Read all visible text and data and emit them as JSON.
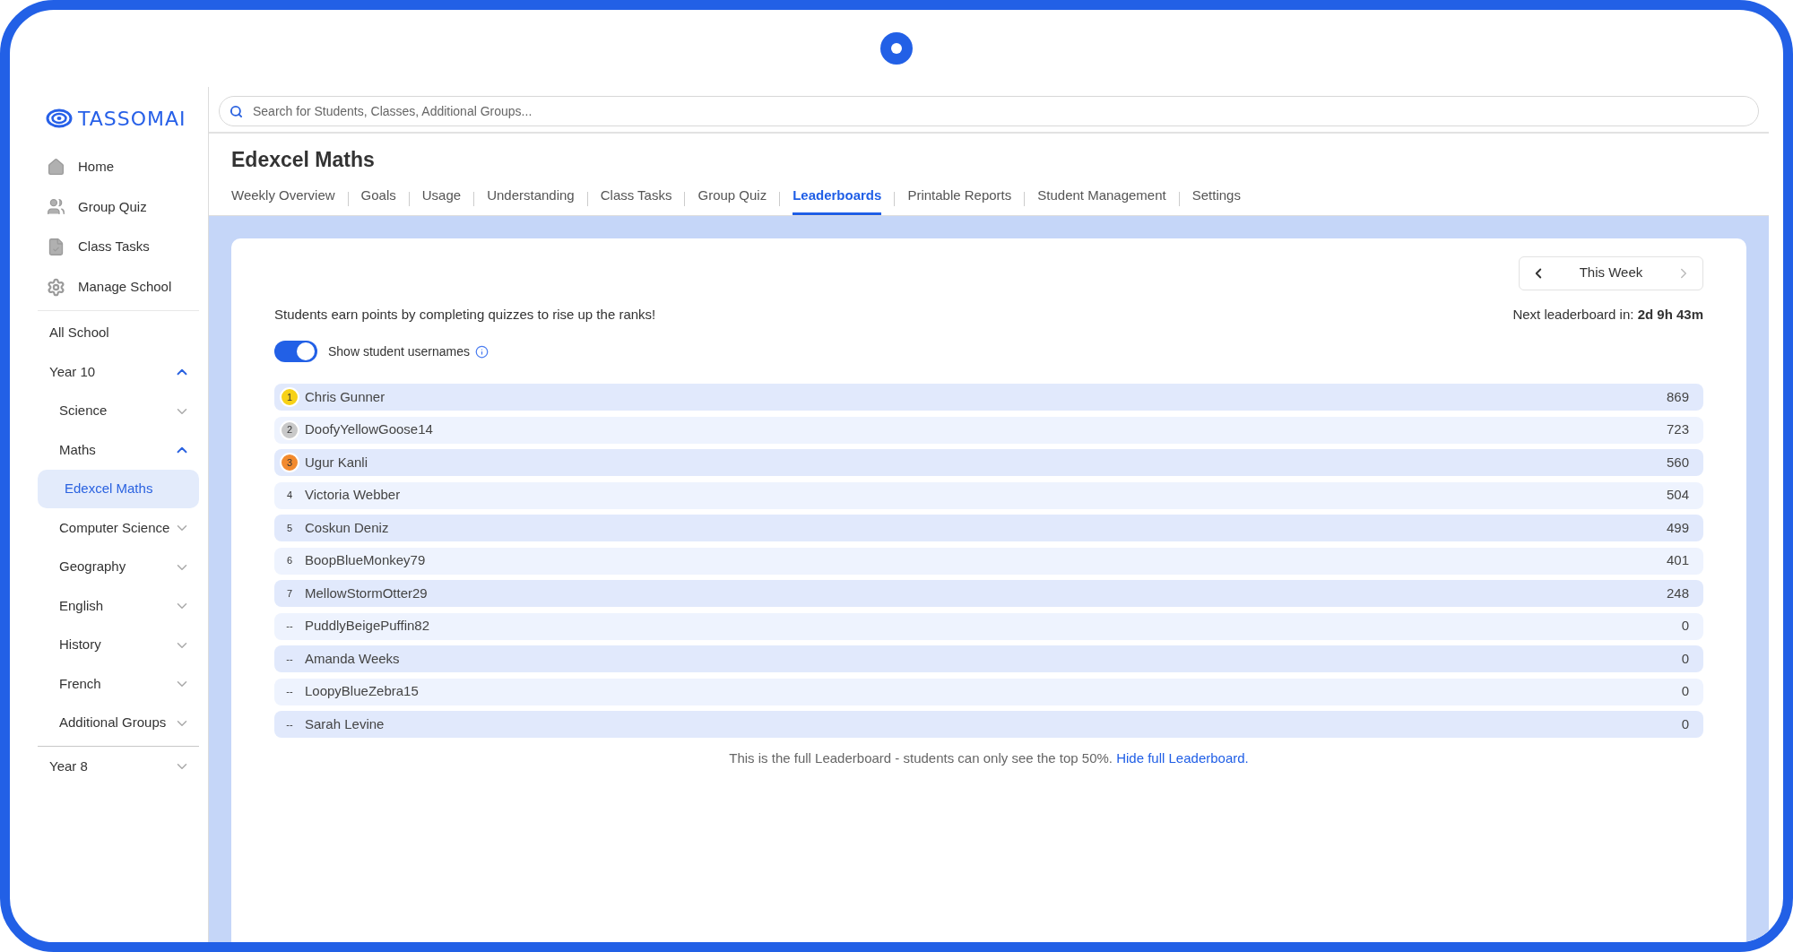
{
  "sidebar": {
    "logo": "TASSOMAI",
    "nav": [
      {
        "label": "Home"
      },
      {
        "label": "Group Quiz"
      },
      {
        "label": "Class Tasks"
      },
      {
        "label": "Manage School"
      }
    ],
    "sections": [
      {
        "items": [
          {
            "label": "All School",
            "selected": false
          },
          {
            "label": "Year 10",
            "selected": false,
            "expanded": true,
            "children": [
              {
                "label": "Science",
                "selected": false,
                "expanded": false
              },
              {
                "label": "Maths",
                "selected": false,
                "expanded": true,
                "children": [
                  {
                    "label": "Edexcel Maths",
                    "selected": true
                  }
                ]
              },
              {
                "label": "Computer Science",
                "selected": false,
                "expanded": false
              },
              {
                "label": "Geography",
                "selected": false,
                "expanded": false
              },
              {
                "label": "English",
                "selected": false,
                "expanded": false
              },
              {
                "label": "History",
                "selected": false,
                "expanded": false
              },
              {
                "label": "French",
                "selected": false,
                "expanded": false
              },
              {
                "label": "Additional Groups",
                "selected": false,
                "expanded": false
              }
            ]
          }
        ]
      },
      {
        "items": [
          {
            "label": "Year 8",
            "selected": false,
            "expanded": false
          }
        ]
      }
    ]
  },
  "search": {
    "placeholder": "Search for Students, Classes, Additional Groups..."
  },
  "page_title": "Edexcel Maths",
  "tabs": [
    {
      "label": "Weekly Overview",
      "selected": false
    },
    {
      "label": "Goals",
      "selected": false
    },
    {
      "label": "Usage",
      "selected": false
    },
    {
      "label": "Understanding",
      "selected": false
    },
    {
      "label": "Class Tasks",
      "selected": false
    },
    {
      "label": "Group Quiz",
      "selected": false
    },
    {
      "label": "Leaderboards",
      "selected": true
    },
    {
      "label": "Printable Reports",
      "selected": false
    },
    {
      "label": "Student Management",
      "selected": false
    },
    {
      "label": "Settings",
      "selected": false
    }
  ],
  "leaderboard": {
    "week_nav": {
      "label": "This Week",
      "next_disabled": true
    },
    "description": "Students earn points by completing quizzes to rise up the ranks!",
    "next_leaderboard": "Next leaderboard in: **2d 9h 43m**",
    "toggle": {
      "label": "Show student usernames",
      "on": true
    },
    "rows": [
      {
        "rank": "1",
        "name": "Chris Gunner",
        "points": "869",
        "color": "#f7d117"
      },
      {
        "rank": "2",
        "name": "DoofyYellowGoose14",
        "points": "723",
        "color": "#c9c9c9"
      },
      {
        "rank": "3",
        "name": "Ugur Kanli",
        "points": "560",
        "color": "#f28a2e"
      },
      {
        "rank": "4",
        "name": "Victoria Webber",
        "points": "504"
      },
      {
        "rank": "5",
        "name": "Coskun Deniz",
        "points": "499"
      },
      {
        "rank": "6",
        "name": "BoopBlueMonkey79",
        "points": "401"
      },
      {
        "rank": "7",
        "name": "MellowStormOtter29",
        "points": "248"
      },
      {
        "rank": "--",
        "name": "PuddlyBeigePuffin82",
        "points": "0"
      },
      {
        "rank": "--",
        "name": "Amanda Weeks",
        "points": "0"
      },
      {
        "rank": "--",
        "name": "LoopyBlueZebra15",
        "points": "0"
      },
      {
        "rank": "--",
        "name": "Sarah Levine",
        "points": "0"
      }
    ],
    "note": "This is the full Leaderboard - students can only see the top 50%.",
    "note_link": "Hide full Leaderboard."
  }
}
